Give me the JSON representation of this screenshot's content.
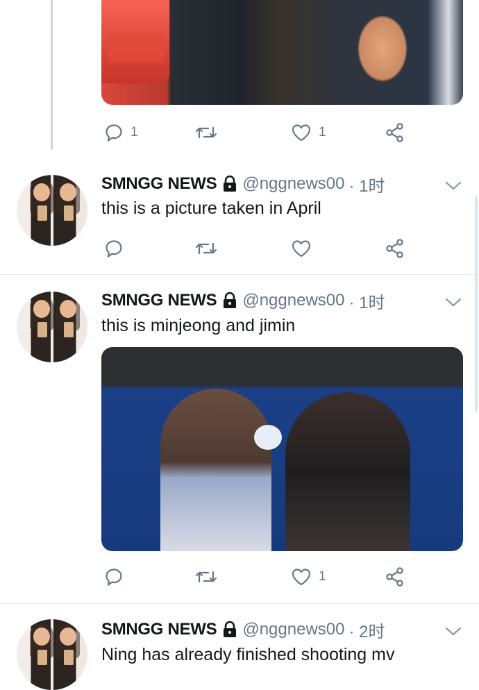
{
  "prev_tweet": {
    "actions": {
      "reply_count": "1",
      "retweet_count": "",
      "like_count": "1"
    }
  },
  "tweets": [
    {
      "name": "SMNGG NEWS",
      "handle": "@nggnews00",
      "time": "· 1时",
      "text": "this is a picture taken in April",
      "actions": {
        "reply_count": "",
        "retweet_count": "",
        "like_count": ""
      }
    },
    {
      "name": "SMNGG NEWS",
      "handle": "@nggnews00",
      "time": "· 1时",
      "text": "this is minjeong and jimin",
      "actions": {
        "reply_count": "",
        "retweet_count": "",
        "like_count": "1"
      }
    },
    {
      "name": "SMNGG NEWS",
      "handle": "@nggnews00",
      "time": "· 2时",
      "text": "Ning has already finished shooting mv"
    }
  ],
  "icons": {
    "reply": "reply-icon",
    "retweet": "retweet-icon",
    "like": "heart-icon",
    "share": "share-icon",
    "lock": "lock-icon",
    "more": "chevron-down-icon"
  },
  "colors": {
    "text": "#14171a",
    "muted": "#657786",
    "icon": "#657786",
    "divider": "#e6ecf0"
  }
}
